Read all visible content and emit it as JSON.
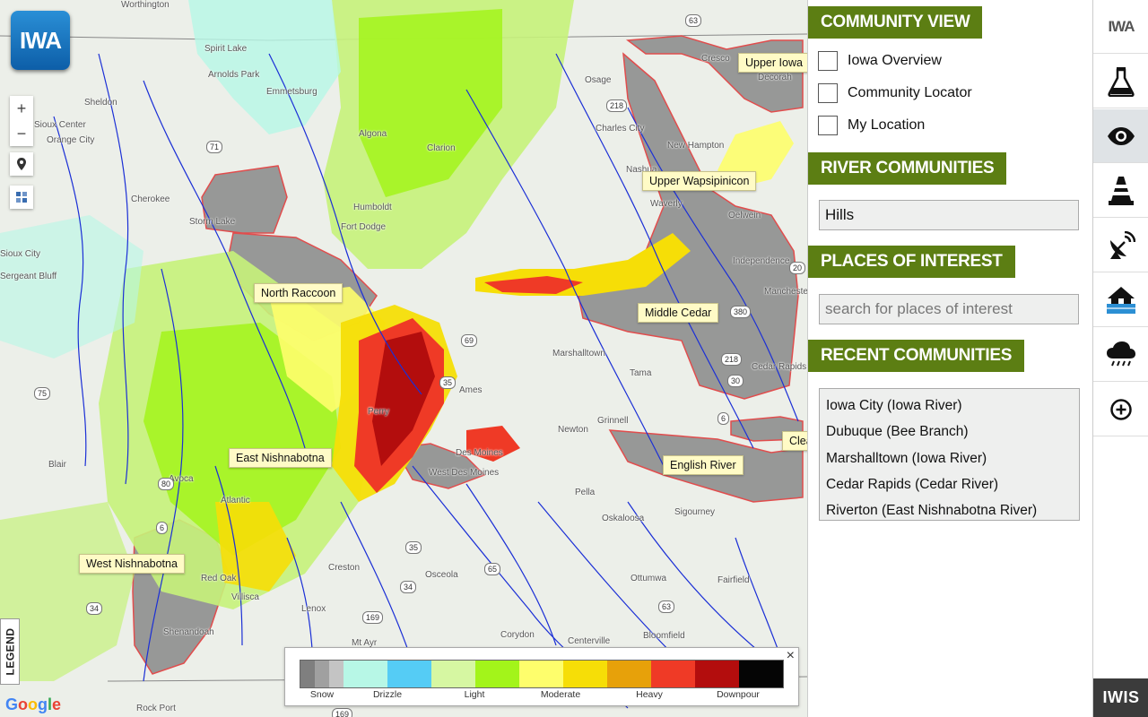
{
  "map": {
    "logo_text": "IWA",
    "zoom_in": "+",
    "zoom_out": "−",
    "legend_tab": "LEGEND",
    "google": [
      "G",
      "o",
      "o",
      "g",
      "l",
      "e"
    ],
    "close": "×",
    "places": [
      "Worthington",
      "Spirit Lake",
      "Arnolds Park",
      "Sheldon",
      "Emmetsburg",
      "Cherokee",
      "Storm Lake",
      "Humboldt",
      "Sioux Center",
      "Orange City",
      "Sioux City",
      "Sergeant Bluff",
      "Charles City",
      "New Hampton",
      "Nashua",
      "Waverly",
      "Decorah",
      "Cresco",
      "Osage",
      "Oelwein",
      "Independence",
      "Manchester",
      "Marshalltown",
      "Tama",
      "Cedar Rapids",
      "Grinnell",
      "Newton",
      "Des Moines",
      "West Des Moines",
      "Pella",
      "Oskaloosa",
      "Sigourney",
      "Ottumwa",
      "Fairfield",
      "Osceola",
      "Creston",
      "Lenox",
      "Mt Ayr",
      "Corydon",
      "Centerville",
      "Bloomfield",
      "Red Oak",
      "Villisca",
      "Shenandoah",
      "Avoca",
      "Atlantic",
      "Blair",
      "Rock Port",
      "Algona",
      "Clarion",
      "Fort Dodge",
      "Ames",
      "Perry"
    ],
    "shields": [
      "63",
      "71",
      "218",
      "20",
      "380",
      "30",
      "218",
      "69",
      "6",
      "65",
      "34",
      "169",
      "63",
      "34",
      "75",
      "80",
      "35",
      "35",
      "6",
      "169"
    ],
    "river_labels": {
      "upper_iowa": "Upper Iowa",
      "upper_wapsipinicon": "Upper Wapsipinicon",
      "north_raccoon": "North Raccoon",
      "middle_cedar": "Middle Cedar",
      "east_nishnabotna": "East Nishnabotna",
      "english_river": "English River",
      "west_nishnabotna": "West Nishnabotna",
      "clear": "Clea"
    },
    "legend": {
      "colors": [
        "#7f7f7f",
        "#a0a0a0",
        "#c4c4c4",
        "#b7f7e6",
        "#55ccf5",
        "#d6f7a2",
        "#a3f41a",
        "#fefe6c",
        "#f6de07",
        "#e7a10a",
        "#ef3a26",
        "#b30d0d",
        "#050505"
      ],
      "labels": [
        "Snow",
        "Drizzle",
        "Light",
        "Moderate",
        "Heavy",
        "Downpour"
      ]
    }
  },
  "panel": {
    "community_view": {
      "title": "COMMUNITY VIEW",
      "options": [
        "Iowa Overview",
        "Community Locator",
        "My Location"
      ]
    },
    "river_communities": {
      "title": "RIVER COMMUNITIES",
      "value": "Hills"
    },
    "places_of_interest": {
      "title": "PLACES OF INTEREST",
      "placeholder": "search for places of interest"
    },
    "recent_communities": {
      "title": "RECENT COMMUNITIES",
      "items": [
        "Iowa City (Iowa River)",
        "Dubuque (Bee Branch)",
        "Marshalltown (Iowa River)",
        "Cedar Rapids (Cedar River)",
        "Riverton (East Nishnabotna River)"
      ]
    }
  },
  "rail": {
    "logo_text": "IWA",
    "icons": [
      "flask-icon",
      "eye-icon",
      "traffic-cone-icon",
      "satellite-dish-icon",
      "flood-house-icon",
      "rain-cloud-icon",
      "add-circle-icon"
    ],
    "bottom_label": "IWIS"
  }
}
